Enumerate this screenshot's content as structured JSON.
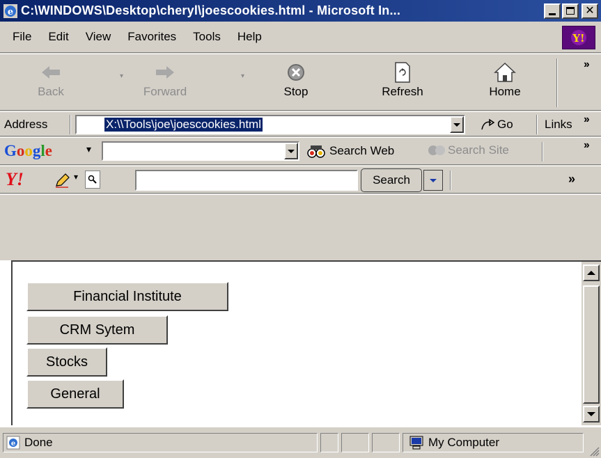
{
  "window": {
    "title": "C:\\WINDOWS\\Desktop\\cheryl\\joescookies.html - Microsoft In..."
  },
  "menu": [
    "File",
    "Edit",
    "View",
    "Favorites",
    "Tools",
    "Help"
  ],
  "toolbar": {
    "back": "Back",
    "forward": "Forward",
    "stop": "Stop",
    "refresh": "Refresh",
    "home": "Home"
  },
  "address": {
    "label": "Address",
    "value": "X:\\\\Tools\\joe\\joescookies.html",
    "go": "Go",
    "links": "Links"
  },
  "google": {
    "logo": "Google",
    "search_web": "Search Web",
    "search_site": "Search Site"
  },
  "yahoo": {
    "logo": "Y!",
    "search_button": "Search",
    "chevron": "»"
  },
  "page": {
    "buttons": [
      "Financial Institute",
      "CRM Sytem",
      "Stocks",
      "General"
    ]
  },
  "status": {
    "text": "Done",
    "zone": "My Computer"
  }
}
